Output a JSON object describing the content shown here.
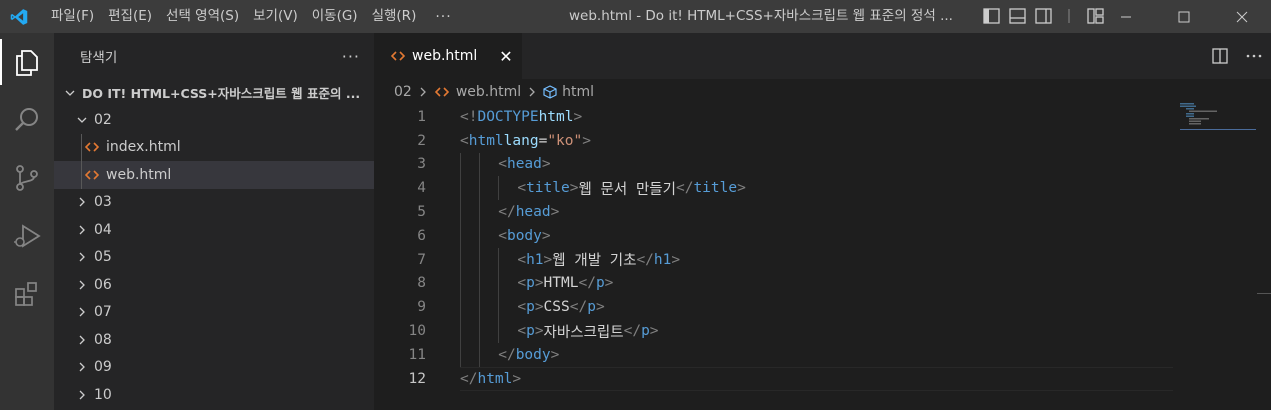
{
  "menu": [
    "파일(F)",
    "편집(E)",
    "선택 영역(S)",
    "보기(V)",
    "이동(G)",
    "실행(R)"
  ],
  "menu_more": "···",
  "window_title": "web.html - Do it! HTML+CSS+자바스크립트 웹 표준의 정석 ...",
  "sidebar": {
    "title": "탐색기",
    "more": "···",
    "root": "DO IT! HTML+CSS+자바스크립트 웹 표준의 ...",
    "folder_open": "02",
    "files": [
      "index.html",
      "web.html"
    ],
    "folders": [
      "03",
      "04",
      "05",
      "06",
      "07",
      "08",
      "09",
      "10"
    ]
  },
  "tab": {
    "label": "web.html",
    "close": "✕"
  },
  "breadcrumb": {
    "folder": "02",
    "file": "web.html",
    "symbol": "html"
  },
  "code_lines": [
    {
      "n": "1",
      "indent": 0,
      "html": "<span class='t-br'>&lt;!</span><span class='t-tag'>DOCTYPE</span> <span class='t-kw'>html</span><span class='t-br'>&gt;</span>"
    },
    {
      "n": "2",
      "indent": 0,
      "html": "<span class='t-br'>&lt;</span><span class='t-tag'>html</span> <span class='t-attr'>lang</span><span class='t-eq'>=</span><span class='t-str'>\"ko\"</span><span class='t-br'>&gt;</span>"
    },
    {
      "n": "3",
      "indent": 2,
      "html": "<span class='t-br'>&lt;</span><span class='t-tag'>head</span><span class='t-br'>&gt;</span>"
    },
    {
      "n": "4",
      "indent": 3,
      "html": "<span class='t-br'>&lt;</span><span class='t-tag'>title</span><span class='t-br'>&gt;</span><span class='t-txt'>웹 문서 만들기</span><span class='t-br'>&lt;/</span><span class='t-tag'>title</span><span class='t-br'>&gt;</span>"
    },
    {
      "n": "5",
      "indent": 2,
      "html": "<span class='t-br'>&lt;/</span><span class='t-tag'>head</span><span class='t-br'>&gt;</span>"
    },
    {
      "n": "6",
      "indent": 2,
      "html": "<span class='t-br'>&lt;</span><span class='t-tag'>body</span><span class='t-br'>&gt;</span>"
    },
    {
      "n": "7",
      "indent": 3,
      "html": "<span class='t-br'>&lt;</span><span class='t-tag'>h1</span><span class='t-br'>&gt;</span><span class='t-txt'>웹 개발 기초</span><span class='t-br'>&lt;/</span><span class='t-tag'>h1</span><span class='t-br'>&gt;</span>"
    },
    {
      "n": "8",
      "indent": 3,
      "html": "<span class='t-br'>&lt;</span><span class='t-tag'>p</span><span class='t-br'>&gt;</span><span class='t-txt'>HTML</span><span class='t-br'>&lt;/</span><span class='t-tag'>p</span><span class='t-br'>&gt;</span>"
    },
    {
      "n": "9",
      "indent": 3,
      "html": "<span class='t-br'>&lt;</span><span class='t-tag'>p</span><span class='t-br'>&gt;</span><span class='t-txt'>CSS</span><span class='t-br'>&lt;/</span><span class='t-tag'>p</span><span class='t-br'>&gt;</span>"
    },
    {
      "n": "10",
      "indent": 3,
      "html": "<span class='t-br'>&lt;</span><span class='t-tag'>p</span><span class='t-br'>&gt;</span><span class='t-txt'>자바스크립트</span><span class='t-br'>&lt;/</span><span class='t-tag'>p</span><span class='t-br'>&gt;</span>"
    },
    {
      "n": "11",
      "indent": 2,
      "html": "<span class='t-br'>&lt;/</span><span class='t-tag'>body</span><span class='t-br'>&gt;</span>"
    },
    {
      "n": "12",
      "indent": 0,
      "html": "<span class='t-br'>&lt;/</span><span class='t-tag'>html</span><span class='t-br'>&gt;</span>"
    }
  ],
  "current_line": "12",
  "icons": {
    "activity": [
      "explorer-icon",
      "search-icon",
      "source-control-icon",
      "run-debug-icon",
      "extensions-icon"
    ],
    "file": "html-file-icon"
  },
  "colors": {
    "accent_vscode_logo": "#23a9f2",
    "html_icon": "#e37933",
    "tag": "#569cd6",
    "attr": "#9cdcfe",
    "string": "#ce9178"
  }
}
